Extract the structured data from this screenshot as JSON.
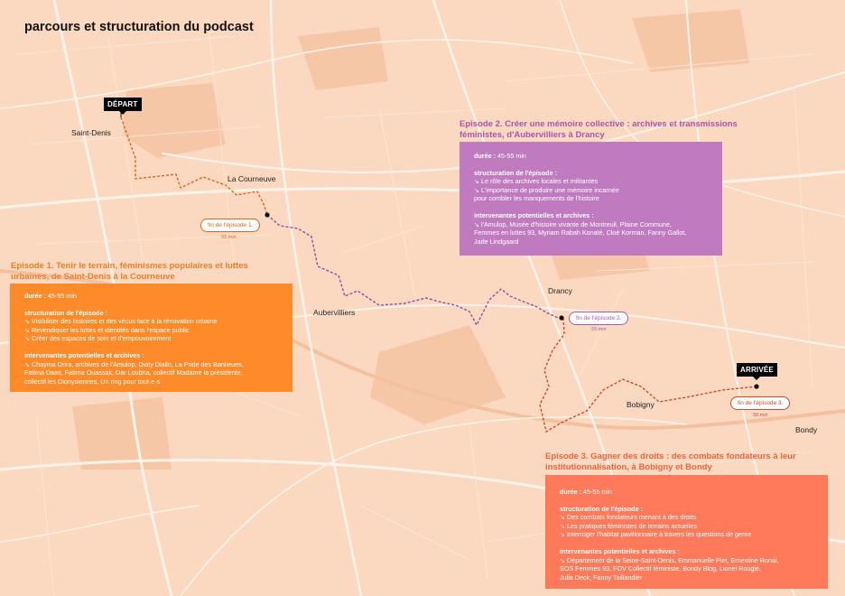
{
  "title": "parcours et structuration du podcast",
  "colors": {
    "background": "#fbd9c1",
    "road": "#fff3ea",
    "park": "#f6c8a8",
    "episode1": "#ff8a2a",
    "episode2": "#c07ac0",
    "episode3": "#ff7a5a",
    "route_orange": "#e0651e",
    "route_purple": "#8a4fb0",
    "route_red": "#d2492b"
  },
  "towns": {
    "saint_denis": "Saint-Denis",
    "la_courneuve": "La Courneuve",
    "aubervilliers": "Aubervilliers",
    "drancy": "Drancy",
    "bobigny": "Bobigny",
    "bondy": "Bondy"
  },
  "markers": {
    "depart": "DÉPART",
    "arrivee": "ARRIVÉE"
  },
  "episode_ends": {
    "ep1": {
      "label": "fin de l'épisode 1.",
      "duration": "55 min"
    },
    "ep2": {
      "label": "fin de l'épisode 2.",
      "duration": "55 min"
    },
    "ep3": {
      "label": "fin de l'épisode 3.",
      "duration": "55 min"
    }
  },
  "episodes": {
    "ep1": {
      "title_line1": "Episode 1. Tenir le terrain, féminismes populaires et luttes",
      "title_line2": "urbaines, de Saint-Denis à la Courneuve",
      "duree_label": "durée :",
      "duree_value": "45-55 min",
      "structuration_label": "structuration de l'épisode :",
      "structuration": [
        "↘ Visibiliser des histoires et des vécus face à la rénovation urbaine",
        "↘ Revendiquer les luttes et identités dans l'espace public",
        "↘ Créer des espaces de soin et d'empouvoirement"
      ],
      "intervenantes_label": "intervenantes potentielles et archives :",
      "intervenantes": [
        "↘ Chayma Drira, archives de l'Amulop, Diaty Diallo, La Pride des Banlieues,",
        "Fatima Daas, Fatima Ouassak, Dar Loubna, collectif Madame la présidente,",
        "collectif les Dionysiennes, Un ring pour tout·e·s"
      ]
    },
    "ep2": {
      "title_line1": "Episode 2. Créer une mémoire collective : archives et transmissions",
      "title_line2": "féministes, d'Aubervilliers à Drancy",
      "duree_label": "durée :",
      "duree_value": "45-55 min",
      "structuration_label": "structuration de l'épisode :",
      "structuration": [
        "↘ Le rôle des archives locales et militantes",
        "↘ L'importance de produire une mémoire incarnée",
        "pour combler les manquements de l'histoire"
      ],
      "intervenantes_label": "intervenantes potentielles et archives :",
      "intervenantes": [
        "↘ l'Amulop, Musée d'histoire vivante de Montreuil, Plaine Commune,",
        "Femmes en luttes 93, Myriam Rabah Konaté, Cloé Korman, Fanny Gallot,",
        "Jade Lindgaard"
      ]
    },
    "ep3": {
      "title_line1": "Episode 3. Gagner des droits : des combats fondateurs à leur",
      "title_line2": "institutionnalisation, à Bobigny et Bondy",
      "duree_label": "durée :",
      "duree_value": "45-55 min",
      "structuration_label": "structuration de l'épisode :",
      "structuration": [
        "↘ Des combats fondateurs menant à des droits",
        "↘ Les pratiques féministes de terrains actuelles",
        "↘ Interroger l'habitat pavillonnaire à travers les questions de genre"
      ],
      "intervenantes_label": "intervenantes potentielles et archives :",
      "intervenantes": [
        "↘ Département de la Seine-Saint-Denis, Emmanuelle Piet, Ernestine Ronai,",
        "SOS Femmes 93, FOV Collectif féministe, Bondy Blog, Lionel Rougié,",
        "Julia Deck, Fanny Taillandier"
      ]
    }
  }
}
